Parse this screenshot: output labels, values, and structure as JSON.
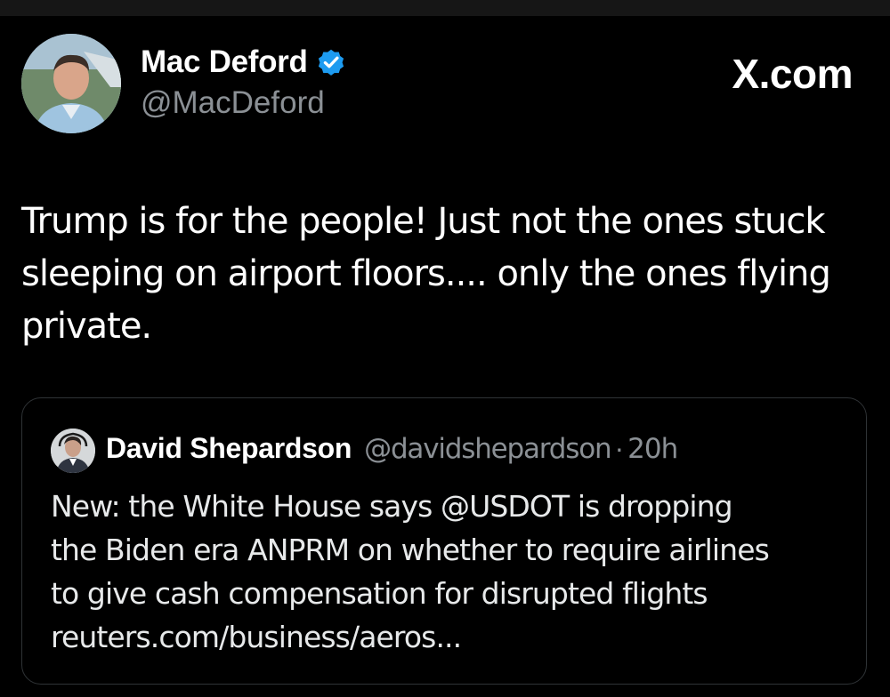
{
  "post": {
    "author": {
      "name": "Mac Deford",
      "handle": "@MacDeford",
      "verified_icon": "verified-badge-icon",
      "avatar_icon": "profile-photo"
    },
    "brand": "X.com",
    "text_lines": [
      "Trump is for the people! Just not the ones stuck",
      "sleeping on airport floors.... only the ones flying",
      "private."
    ]
  },
  "quoted_post": {
    "author": {
      "name": "David Shepardson",
      "handle": "@davidshepardson",
      "avatar_icon": "profile-photo"
    },
    "separator": "·",
    "time": "20h",
    "text_lines": [
      "New: the White House says @USDOT is dropping",
      "the Biden era ANPRM on whether to require airlines",
      "to give cash compensation for disrupted flights",
      "reuters.com/business/aeros..."
    ]
  },
  "colors": {
    "background": "#000000",
    "primary_text": "#ffffff",
    "secondary_text": "#8b9095",
    "verified_blue": "#1d9bf0",
    "card_border": "#2f3336"
  }
}
